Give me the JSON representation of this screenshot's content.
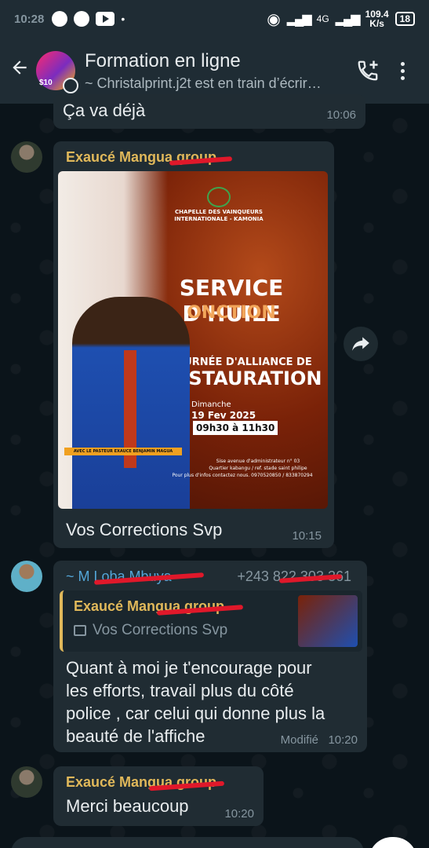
{
  "status_bar": {
    "time": "10:28",
    "network": "4G",
    "speed_value": "109.4",
    "speed_unit": "K/s",
    "battery": "18"
  },
  "header": {
    "title": "Formation en ligne",
    "subtitle": "~ Christalprint.j2t est en train d’écrir…",
    "avatar_text": "$10"
  },
  "messages": [
    {
      "text": "Ça va déjà",
      "time": "10:06"
    },
    {
      "sender": "Exaucé Mangua group",
      "poster": {
        "org_line1": "CHAPELLE DES VAINQUEURS",
        "org_line2": "INTERNATIONALE - KAMONIA",
        "headline": "SERVICE D'HUILE",
        "subheadline": "ONCTION",
        "line_small": "JOURNÉE D'ALLIANCE DE",
        "line_big": "RESTAURATION",
        "day": "Dimanche",
        "date": "19 Fev 2025",
        "hours": "09h30 à 11h30",
        "pastor": "AVEC LE PASTEUR EXAUCE BENJAMIN MAGUA",
        "address1": "Sise avenue d'administrateur n° 03",
        "address2": "Quartier kabangu / ref. stade saint philipe",
        "contact": "Pour plus d'infos contactez nous. 0970520850 / 833870294"
      },
      "caption": "Vos Corrections Svp",
      "time": "10:15"
    },
    {
      "sender": "~ M Loba Mbuya",
      "phone": "+243 822 303 361",
      "quote_sender": "Exaucé Mangua group",
      "quote_text": "Vos Corrections Svp",
      "lines": [
        "Quant à moi je t'encourage pour",
        "les efforts, travail plus du côté",
        "police , car celui qui donne plus la",
        "beauté de l'affiche"
      ],
      "edited": "Modifié",
      "time": "10:20"
    },
    {
      "sender": "Exaucé Mangua group",
      "text": "Merci beaucoup",
      "time": "10:20"
    }
  ],
  "icons": {
    "back": "arrow-left-icon",
    "add_call": "add-call-icon",
    "menu": "more-vert-icon",
    "forward": "forward-icon",
    "image": "image-icon"
  },
  "colors": {
    "background": "#0b141a",
    "bar": "#1f2c34",
    "bubble": "#202c33",
    "sender": "#e0b85a",
    "secondary_text": "#8696a0",
    "redaction": "#e0182a"
  }
}
